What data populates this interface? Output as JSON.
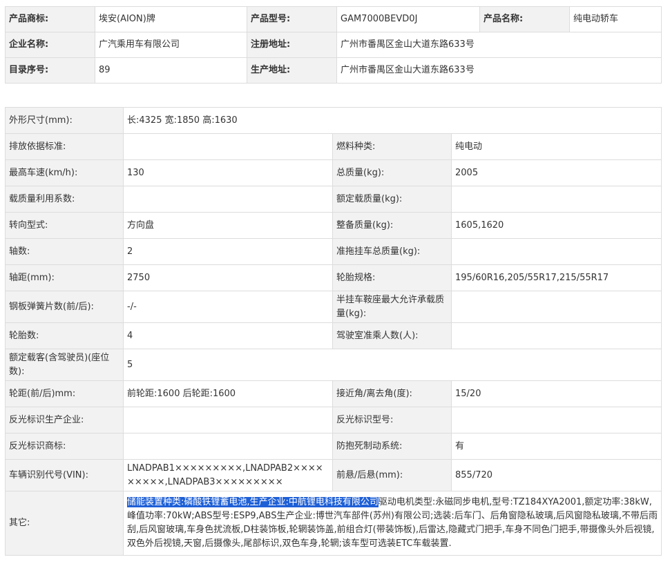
{
  "header": {
    "brand_label": "产品商标:",
    "brand_value": "埃安(AION)牌",
    "model_label": "产品型号:",
    "model_value": "GAM7000BEVD0J",
    "name_label": "产品名称:",
    "name_value": "纯电动轿车",
    "company_label": "企业名称:",
    "company_value": "广汽乘用车有限公司",
    "reg_addr_label": "注册地址:",
    "reg_addr_value": "广州市番禺区金山大道东路633号",
    "catalog_label": "目录序号:",
    "catalog_value": "89",
    "prod_addr_label": "生产地址:",
    "prod_addr_value": "广州市番禺区金山大道东路633号"
  },
  "specs": {
    "dimensions_label": "外形尺寸(mm):",
    "dimensions_value": "长:4325 宽:1850 高:1630",
    "emission_label": "排放依据标准:",
    "emission_value": "",
    "fuel_label": "燃料种类:",
    "fuel_value": "纯电动",
    "speed_label": "最高车速(km/h):",
    "speed_value": "130",
    "total_mass_label": "总质量(kg):",
    "total_mass_value": "2005",
    "load_coef_label": "载质量利用系数:",
    "load_coef_value": "",
    "rated_load_label": "额定载质量(kg):",
    "rated_load_value": "",
    "steering_label": "转向型式:",
    "steering_value": "方向盘",
    "curb_mass_label": "整备质量(kg):",
    "curb_mass_value": "1605,1620",
    "axles_label": "轴数:",
    "axles_value": "2",
    "trailer_mass_label": "准拖挂车总质量(kg):",
    "trailer_mass_value": "",
    "wheelbase_label": "轴距(mm):",
    "wheelbase_value": "2750",
    "tire_spec_label": "轮胎规格:",
    "tire_spec_value": "195/60R16,205/55R17,215/55R17",
    "spring_label": "钢板弹簧片数(前/后):",
    "spring_value": "-/-",
    "saddle_label": "半挂车鞍座最大允许承载质量(kg):",
    "saddle_value": "",
    "tires_label": "轮胎数:",
    "tires_value": "4",
    "cab_label": "驾驶室准乘人数(人):",
    "cab_value": "",
    "seats_label": "额定载客(含驾驶员)(座位数):",
    "seats_value": "5",
    "track_label": "轮距(前/后)mm:",
    "track_value": "前轮距:1600 后轮距:1600",
    "angle_label": "接近角/离去角(度):",
    "angle_value": "15/20",
    "reflector_maker_label": "反光标识生产企业:",
    "reflector_maker_value": "",
    "reflector_model_label": "反光标识型号:",
    "reflector_model_value": "",
    "reflector_brand_label": "反光标识商标:",
    "reflector_brand_value": "",
    "abs_label": "防抱死制动系统:",
    "abs_value": "有",
    "vin_label": "车辆识别代号(VIN):",
    "vin_value": "LNADPAB1×××××××××,LNADPAB2×××××××××,LNADPAB3×××××××××",
    "overhang_label": "前悬/后悬(mm):",
    "overhang_value": "855/720",
    "other_label": "其它:",
    "other_highlight": "储能装置种类:磷酸铁锂蓄电池,生产企业:中航锂电科技有限公司",
    "other_value": "驱动电机类型:永磁同步电机,型号:TZ184XYA2001,额定功率:38kW,峰值功率:70kW;ABS型号:ESP9,ABS生产企业:博世汽车部件(苏州)有限公司;选装:后车门、后角窗隐私玻璃,后风窗隐私玻璃,不带后雨刮,后风窗玻璃,车身色扰流板,D柱装饰板,轮辋装饰盖,前组合灯(带装饰板),后雷达,隐藏式门把手,车身不同色门把手,带摄像头外后视镜,双色外后视镜,天窗,后摄像头,尾部标识,双色车身,轮辋;该车型可选装ETC车载装置."
  }
}
